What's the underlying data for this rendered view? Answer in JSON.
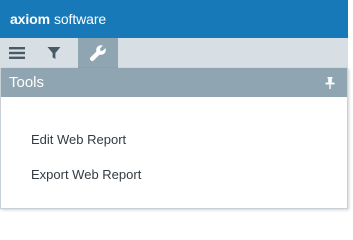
{
  "header": {
    "brand": "axiom",
    "product": "software"
  },
  "toolbar": {
    "tabs": [
      {
        "name": "menu",
        "icon": "hamburger-menu-icon",
        "active": false
      },
      {
        "name": "filter",
        "icon": "filter-icon",
        "active": false
      },
      {
        "name": "tools",
        "icon": "wrench-icon",
        "active": true
      }
    ]
  },
  "panel": {
    "title": "Tools",
    "pin_icon": "pin-icon",
    "items": [
      {
        "label": "Edit Web Report"
      },
      {
        "label": "Export Web Report"
      }
    ]
  },
  "colors": {
    "header_bg": "#1779b8",
    "toolbar_bg": "#d7dfe5",
    "active_tab_bg": "#8fa6b2",
    "panel_header_bg": "#8fa6b2",
    "text": "#333b40"
  }
}
